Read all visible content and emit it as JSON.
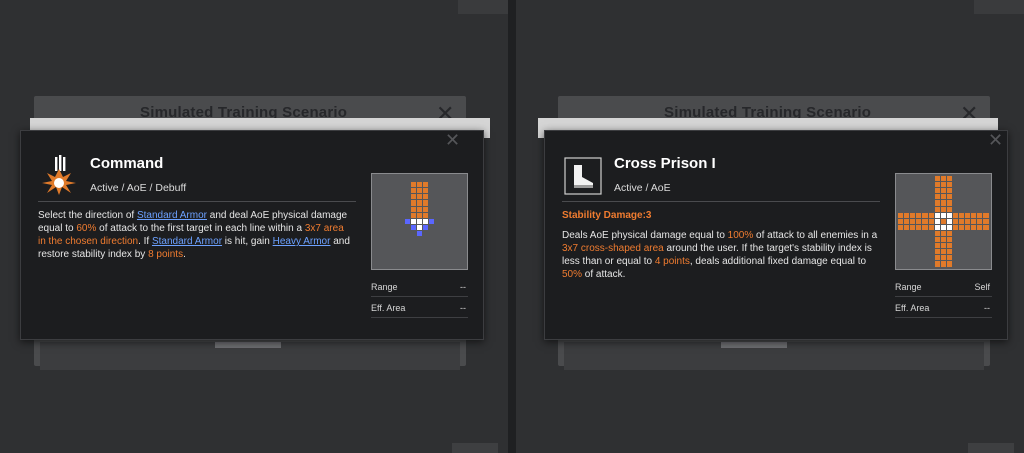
{
  "colors": {
    "highlight": "#f07c30",
    "link": "#6ca1ff",
    "cell_orange": "#e07a2a",
    "cell_white": "#ffffff",
    "cell_blue": "#5a66ff"
  },
  "panels": [
    {
      "background": {
        "title": "Simulated Training Scenario",
        "close": "✕"
      },
      "popup": {
        "icon": "explosion-icon",
        "close": "✕",
        "title": "Command",
        "type": "Active / AoE / Debuff",
        "stability": "",
        "desc_parts": [
          {
            "t": "Select the direction of ",
            "k": "n"
          },
          {
            "t": "Standard Armor",
            "k": "l"
          },
          {
            "t": " and deal AoE physical damage equal to ",
            "k": "n"
          },
          {
            "t": "60%",
            "k": "h"
          },
          {
            "t": " of attack to the first target in each line within a ",
            "k": "n"
          },
          {
            "t": "3x7 area in the chosen direction",
            "k": "h"
          },
          {
            "t": ". If ",
            "k": "n"
          },
          {
            "t": "Standard Armor",
            "k": "l"
          },
          {
            "t": " is hit, gain ",
            "k": "n"
          },
          {
            "t": "Heavy Armor",
            "k": "l"
          },
          {
            "t": " and restore stability index by ",
            "k": "n"
          },
          {
            "t": "8 points",
            "k": "h"
          },
          {
            "t": ".",
            "k": "n"
          }
        ],
        "range_label": "Range",
        "range_value": "--",
        "area_label": "Eff. Area",
        "area_value": "--"
      }
    },
    {
      "background": {
        "title": "Simulated Training Scenario",
        "close": "✕"
      },
      "popup": {
        "icon": "boot-icon",
        "close": "✕",
        "title": "Cross Prison I",
        "type": "Active / AoE",
        "stability": "Stability Damage:3",
        "desc_parts": [
          {
            "t": "Deals AoE physical damage equal to ",
            "k": "n"
          },
          {
            "t": "100%",
            "k": "h"
          },
          {
            "t": " of attack to all enemies in a ",
            "k": "n"
          },
          {
            "t": "3x7 cross-shaped area",
            "k": "h"
          },
          {
            "t": " around the user. If the target's stability index is less than or equal to ",
            "k": "n"
          },
          {
            "t": "4 points",
            "k": "h"
          },
          {
            "t": ", deals additional fixed damage equal to ",
            "k": "n"
          },
          {
            "t": "50%",
            "k": "h"
          },
          {
            "t": " of attack.",
            "k": "n"
          }
        ],
        "range_label": "Range",
        "range_value": "Self",
        "area_label": "Eff. Area",
        "area_value": "--"
      }
    }
  ]
}
